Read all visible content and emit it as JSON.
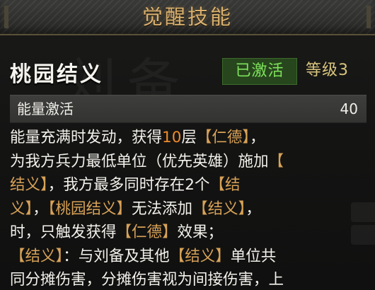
{
  "header": {
    "title": "觉醒技能"
  },
  "skill": {
    "name": "桃园结义",
    "status": "已激活",
    "level": "等级3"
  },
  "energy": {
    "label": "能量激活",
    "value": "40"
  },
  "description": {
    "l1": [
      "能量充满时发动，获得",
      "10",
      "层",
      "【仁德】",
      "，"
    ],
    "l2": [
      "为我方兵力最低单位（优先英雄）施加",
      "【"
    ],
    "l3": [
      "结义】",
      "，我方最多同时存在2个",
      "【结"
    ],
    "l4": [
      "义】",
      "，",
      "【桃园结义】",
      "无法添加",
      "【结义】",
      "，"
    ],
    "l5": [
      "时，只触发获得",
      "【仁德】",
      "效果；"
    ],
    "l6": [
      "【结义】",
      "：与刘备及其他",
      "【结义】",
      "单位共"
    ],
    "l7": [
      "同分摊伤害，分摊伤害视为间接伤害，上"
    ]
  },
  "colors": {
    "header_text": "#d9b06d",
    "keyword": "#d8a257",
    "number": "#f08a2b",
    "active_green": "#7ee35c",
    "level_gold": "#d8c47d"
  }
}
